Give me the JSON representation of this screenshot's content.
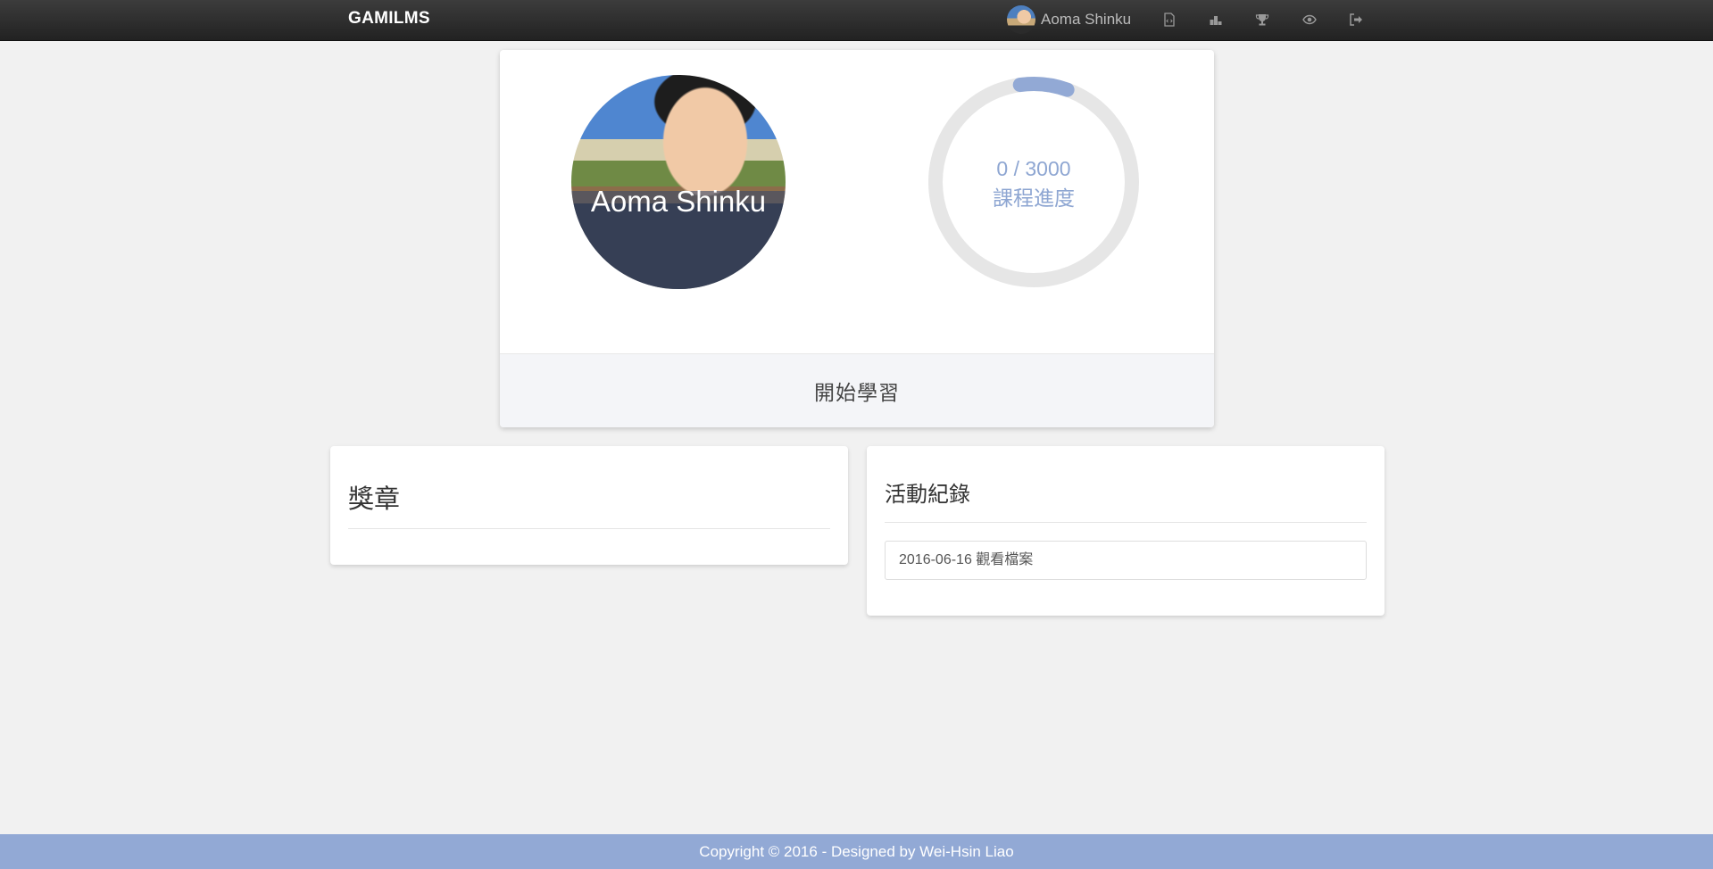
{
  "navbar": {
    "brand": "GAMILMS",
    "user_name": "Aoma Shinku",
    "icons": [
      "file-code-icon",
      "podium-icon",
      "trophy-icon",
      "eye-icon",
      "logout-icon"
    ]
  },
  "profile": {
    "name": "Aoma Shinku",
    "progress_current": 0,
    "progress_total": 3000,
    "progress_text": "0 / 3000",
    "progress_label": "課程進度",
    "start_button": "開始學習"
  },
  "badges": {
    "title": "獎章"
  },
  "activity": {
    "title": "活動紀錄",
    "items": [
      "2016-06-16 觀看檔案"
    ]
  },
  "footer": {
    "text": "Copyright © 2016 - Designed by Wei-Hsin Liao"
  },
  "colors": {
    "accent": "#92a9d5",
    "navbar": "#2a2a2a",
    "ring_track": "#e6e6e6"
  }
}
